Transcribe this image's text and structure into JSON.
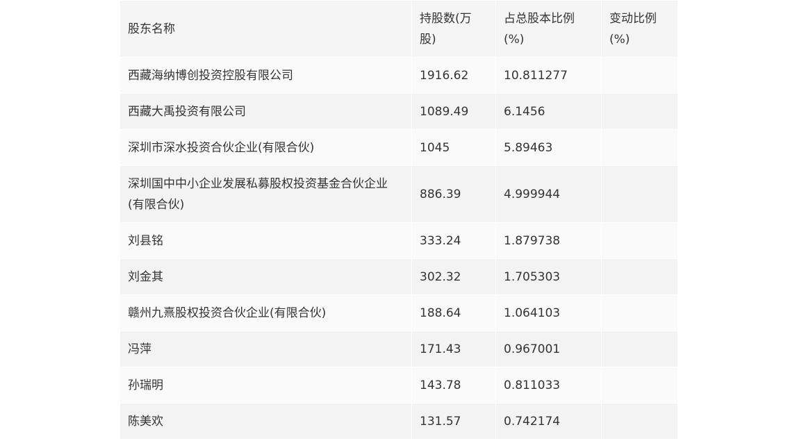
{
  "table": {
    "headers": [
      "股东名称",
      "持股数(万股)",
      "占总股本比例(%)",
      "变动比例(%)"
    ],
    "rows": [
      {
        "name": "西藏海纳博创投资控股有限公司",
        "shares": "1916.62",
        "ratio": "10.811277",
        "change": ""
      },
      {
        "name": "西藏大禹投资有限公司",
        "shares": "1089.49",
        "ratio": "6.1456",
        "change": ""
      },
      {
        "name": "深圳市深水投资合伙企业(有限合伙)",
        "shares": "1045",
        "ratio": "5.89463",
        "change": ""
      },
      {
        "name": "深圳国中中小企业发展私募股权投资基金合伙企业(有限合伙)",
        "shares": "886.39",
        "ratio": "4.999944",
        "change": ""
      },
      {
        "name": "刘县铭",
        "shares": "333.24",
        "ratio": "1.879738",
        "change": ""
      },
      {
        "name": "刘金其",
        "shares": "302.32",
        "ratio": "1.705303",
        "change": ""
      },
      {
        "name": "赣州九熹股权投资合伙企业(有限合伙)",
        "shares": "188.64",
        "ratio": "1.064103",
        "change": ""
      },
      {
        "name": "冯萍",
        "shares": "171.43",
        "ratio": "0.967001",
        "change": ""
      },
      {
        "name": "孙瑞明",
        "shares": "143.78",
        "ratio": "0.811033",
        "change": ""
      },
      {
        "name": "陈美欢",
        "shares": "131.57",
        "ratio": "0.742174",
        "change": ""
      }
    ]
  }
}
